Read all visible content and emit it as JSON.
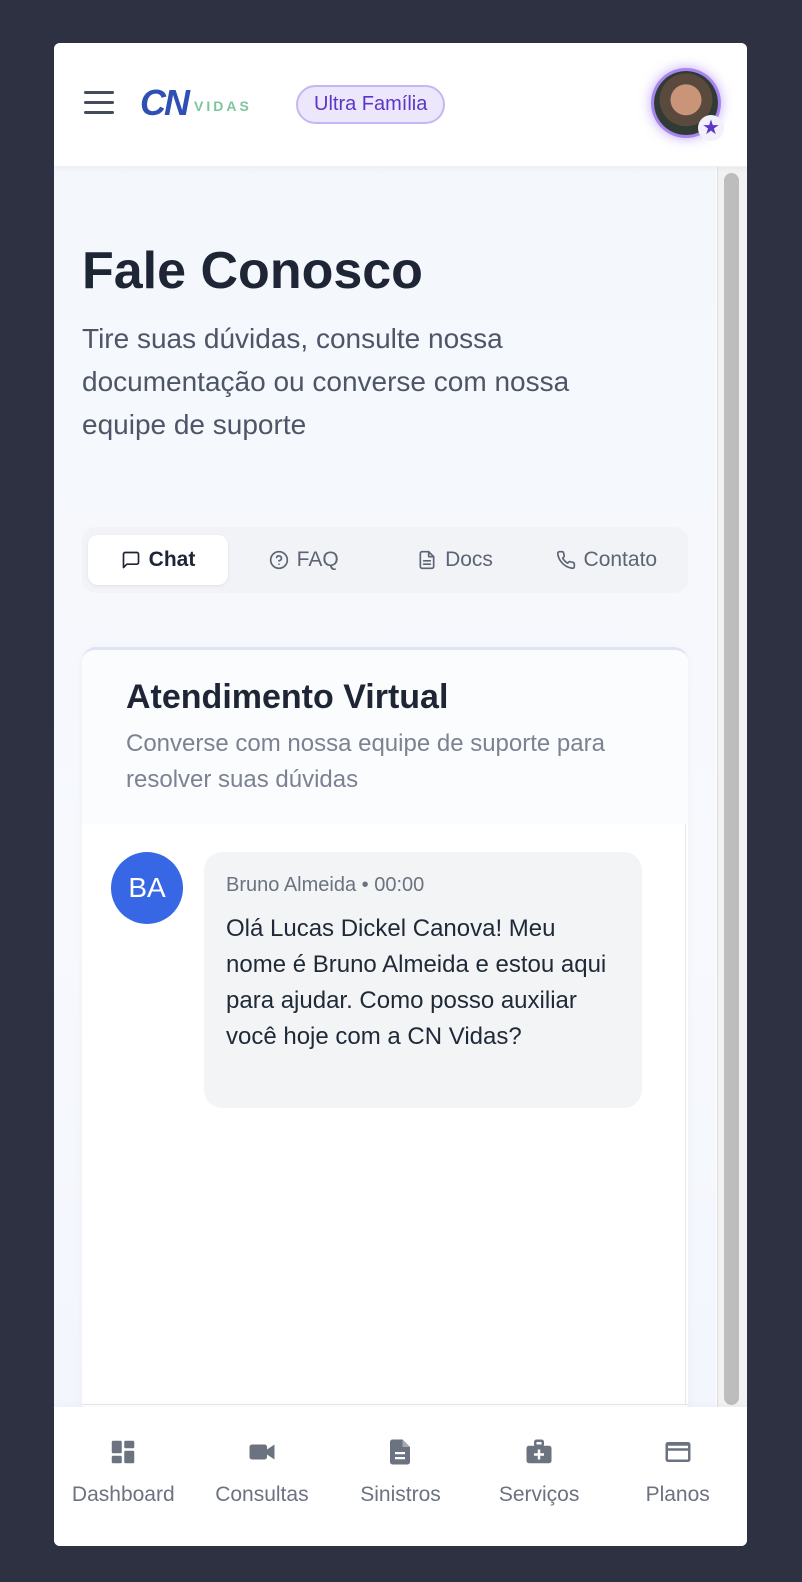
{
  "header": {
    "logo_cn": "CN",
    "logo_vidas": "VIDAS",
    "plan_badge": "Ultra Família",
    "avatar_badge_icon": "star-icon"
  },
  "page": {
    "title": "Fale Conosco",
    "subtitle": "Tire suas dúvidas, consulte nossa documentação ou converse com nossa equipe de suporte"
  },
  "tabs": [
    {
      "label": "Chat",
      "icon": "message-square-icon",
      "active": true
    },
    {
      "label": "FAQ",
      "icon": "help-circle-icon",
      "active": false
    },
    {
      "label": "Docs",
      "icon": "file-text-icon",
      "active": false
    },
    {
      "label": "Contato",
      "icon": "phone-icon",
      "active": false
    }
  ],
  "chat": {
    "title": "Atendimento Virtual",
    "description": "Converse com nossa equipe de suporte para resolver suas dúvidas",
    "messages": [
      {
        "avatar_initials": "BA",
        "meta": "Bruno Almeida • 00:00",
        "text": "Olá Lucas Dickel Canova! Meu nome é Bruno Almeida e estou aqui para ajudar. Como posso auxiliar você hoje com a CN Vidas?"
      }
    ],
    "input_value": "",
    "input_placeholder": ""
  },
  "nav": [
    {
      "label": "Dashboard",
      "icon": "dashboard-icon"
    },
    {
      "label": "Consultas",
      "icon": "video-icon"
    },
    {
      "label": "Sinistros",
      "icon": "document-icon"
    },
    {
      "label": "Serviços",
      "icon": "medical-bag-icon"
    },
    {
      "label": "Planos",
      "icon": "credit-card-icon"
    }
  ],
  "colors": {
    "background": "#2d3142",
    "brand_blue": "#2f4fb5",
    "brand_green": "#7dc59a",
    "accent_purple": "#5b36c7",
    "avatar_blue": "#3867e6",
    "send_button": "#a9bdf5"
  }
}
